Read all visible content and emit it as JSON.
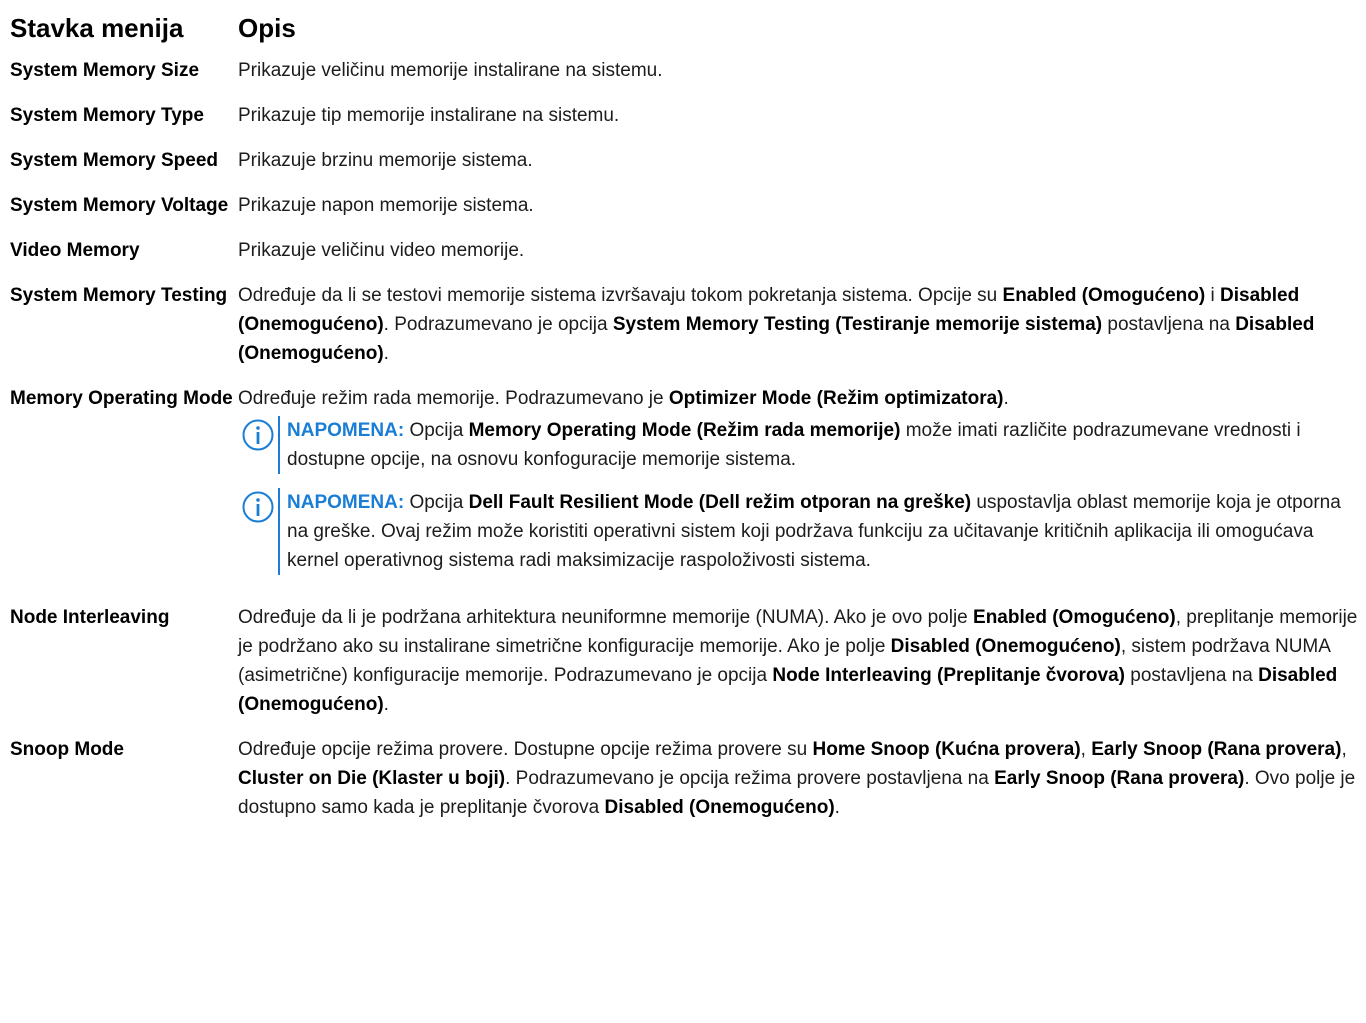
{
  "header": {
    "item": "Stavka menija",
    "description": "Opis"
  },
  "rows": [
    {
      "item": "System Memory Size",
      "desc": "Prikazuje veličinu memorije instalirane na sistemu."
    },
    {
      "item": "System Memory Type",
      "desc": "Prikazuje tip memorije instalirane na sistemu."
    },
    {
      "item": "System Memory Speed",
      "desc": "Prikazuje brzinu memorije sistema."
    },
    {
      "item": "System Memory Voltage",
      "desc": "Prikazuje napon memorije sistema."
    },
    {
      "item": "Video Memory",
      "desc": "Prikazuje veličinu video memorije."
    },
    {
      "item": "System Memory Testing",
      "desc_parts": [
        "Određuje da li se testovi memorije sistema izvršavaju tokom pokretanja sistema. Opcije su ",
        "Enabled (Omogućeno)",
        " i ",
        "Disabled (Onemogućeno)",
        ". Podrazumevano je opcija ",
        "System Memory Testing (Testiranje memorije sistema)",
        " postavljena na ",
        "Disabled (Onemogućeno)",
        "."
      ]
    },
    {
      "item": "Memory Operating Mode",
      "desc_parts": [
        "Određuje režim rada memorije. Podrazumevano je ",
        "Optimizer Mode (Režim optimizatora)",
        "."
      ],
      "notes": [
        {
          "label": "NAPOMENA:",
          "parts": [
            " Opcija ",
            "Memory Operating Mode (Režim rada memorije)",
            " može imati različite podrazumevane vrednosti i dostupne opcije, na osnovu konfoguracije memorije sistema."
          ]
        },
        {
          "label": "NAPOMENA:",
          "parts": [
            " Opcija ",
            "Dell Fault Resilient Mode (Dell režim otporan na greške)",
            " uspostavlja oblast memorije koja je otporna na greške. Ovaj režim može koristiti operativni sistem koji podržava funkciju za učitavanje kritičnih aplikacija ili omogućava kernel operativnog sistema radi maksimizacije raspoloživosti sistema."
          ]
        }
      ]
    },
    {
      "item": "Node Interleaving",
      "desc_parts": [
        "Određuje da li je podržana arhitektura neuniformne memorije (NUMA). Ako je ovo polje ",
        "Enabled (Omogućeno)",
        ", preplitanje memorije je podržano ako su instalirane simetrične konfiguracije memorije. Ako je polje ",
        "Disabled (Onemogućeno)",
        ", sistem podržava NUMA (asimetrične) konfiguracije memorije. Podrazumevano je opcija ",
        "Node Interleaving (Preplitanje čvorova)",
        " postavljena na ",
        "Disabled (Onemogućeno)",
        "."
      ]
    },
    {
      "item": "Snoop Mode",
      "desc_parts": [
        "Određuje opcije režima provere. Dostupne opcije režima provere su ",
        "Home Snoop (Kućna provera)",
        ", ",
        "Early Snoop (Rana provera)",
        ", ",
        "Cluster on Die (Klaster u boji)",
        ". Podrazumevano je opcija režima provere postavljena na ",
        "Early Snoop (Rana provera)",
        ". Ovo polje je dostupno samo kada je preplitanje čvorova ",
        "Disabled (Onemogućeno)",
        "."
      ]
    }
  ],
  "colors": {
    "note_accent": "#1a7ed4",
    "text": "#1c1c1c"
  },
  "icons": {
    "note": "info-circle-icon"
  }
}
